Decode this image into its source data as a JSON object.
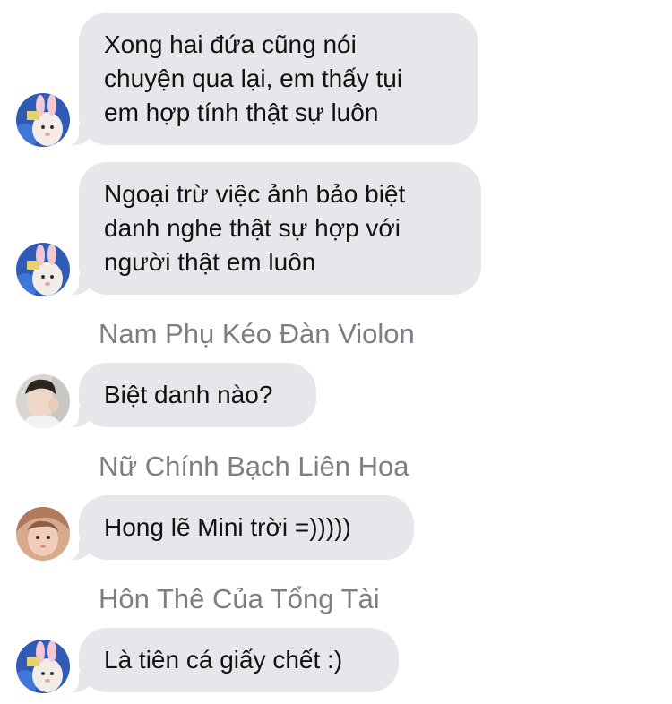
{
  "messages": [
    {
      "lines": [
        "Xong hai đứa cũng nói",
        "chuyện qua lại, em thấy tụi",
        "em hợp tính thật sự luôn"
      ],
      "avatar": "blue-bunny-avatar-icon"
    },
    {
      "lines": [
        "Ngoại trừ việc ảnh bảo biệt",
        "danh nghe thật sự hợp với",
        "người thật em luôn"
      ],
      "avatar": "blue-bunny-avatar-icon"
    },
    {
      "sender": "Nam Phụ Kéo Đàn Violon",
      "lines": [
        "Biệt danh nào?"
      ],
      "avatar": "boy-photo-avatar-icon"
    },
    {
      "sender": "Nữ Chính Bạch Liên Hoa",
      "lines": [
        "Hong lẽ Mini trời =)))))"
      ],
      "avatar": "warm-photo-avatar-icon"
    },
    {
      "sender": "Hôn Thê Của Tổng Tài",
      "lines": [
        "Là tiên cá giấy chết :)"
      ],
      "avatar": "blue-bunny-avatar-icon"
    }
  ],
  "colors": {
    "bubble": "#e6e6eb",
    "text": "#111111",
    "sender": "#7d7d84",
    "background": "#ffffff"
  }
}
